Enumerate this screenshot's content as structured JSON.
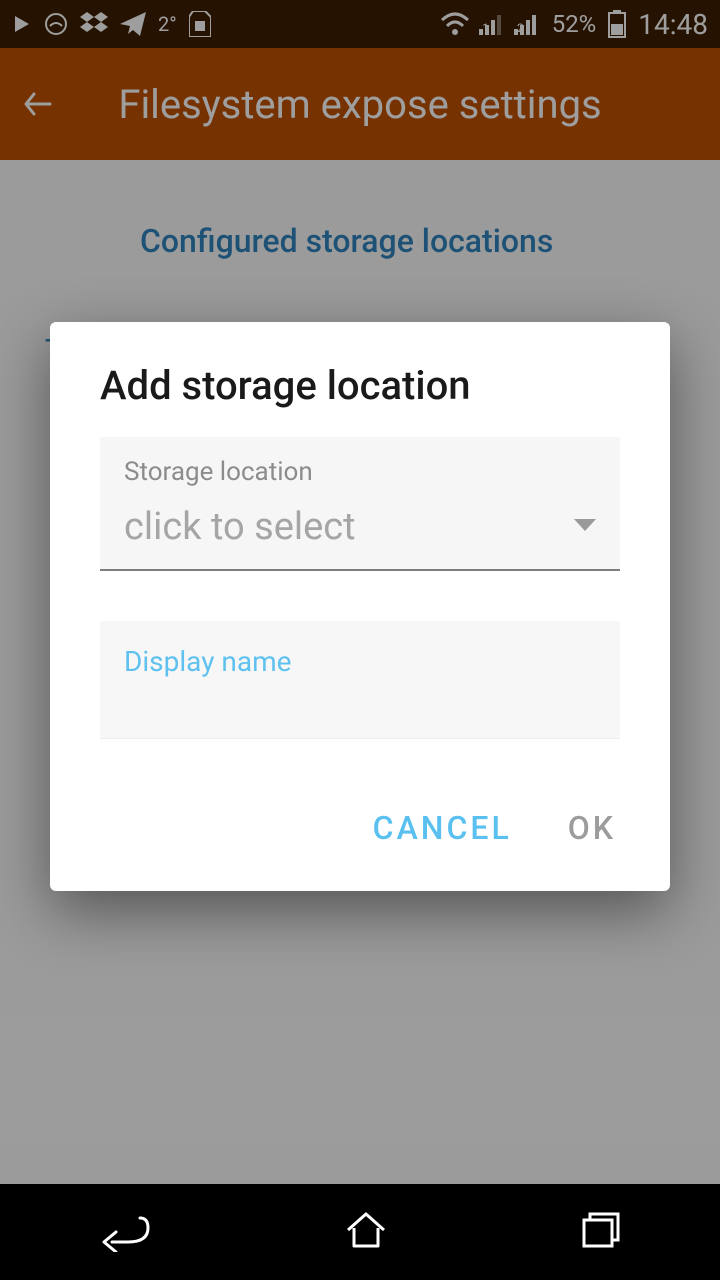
{
  "status": {
    "temp": "2°",
    "battery_pct": "52%",
    "clock": "14:48",
    "sim1": "1",
    "sim2": "2"
  },
  "appbar": {
    "title": "Filesystem expose settings"
  },
  "content": {
    "section_title": "Configured storage locations",
    "add_label": "Add storage location"
  },
  "dialog": {
    "title": "Add storage location",
    "storage_label": "Storage location",
    "storage_placeholder": "click to select",
    "display_label": "Display name",
    "cancel": "CANCEL",
    "ok": "OK"
  }
}
